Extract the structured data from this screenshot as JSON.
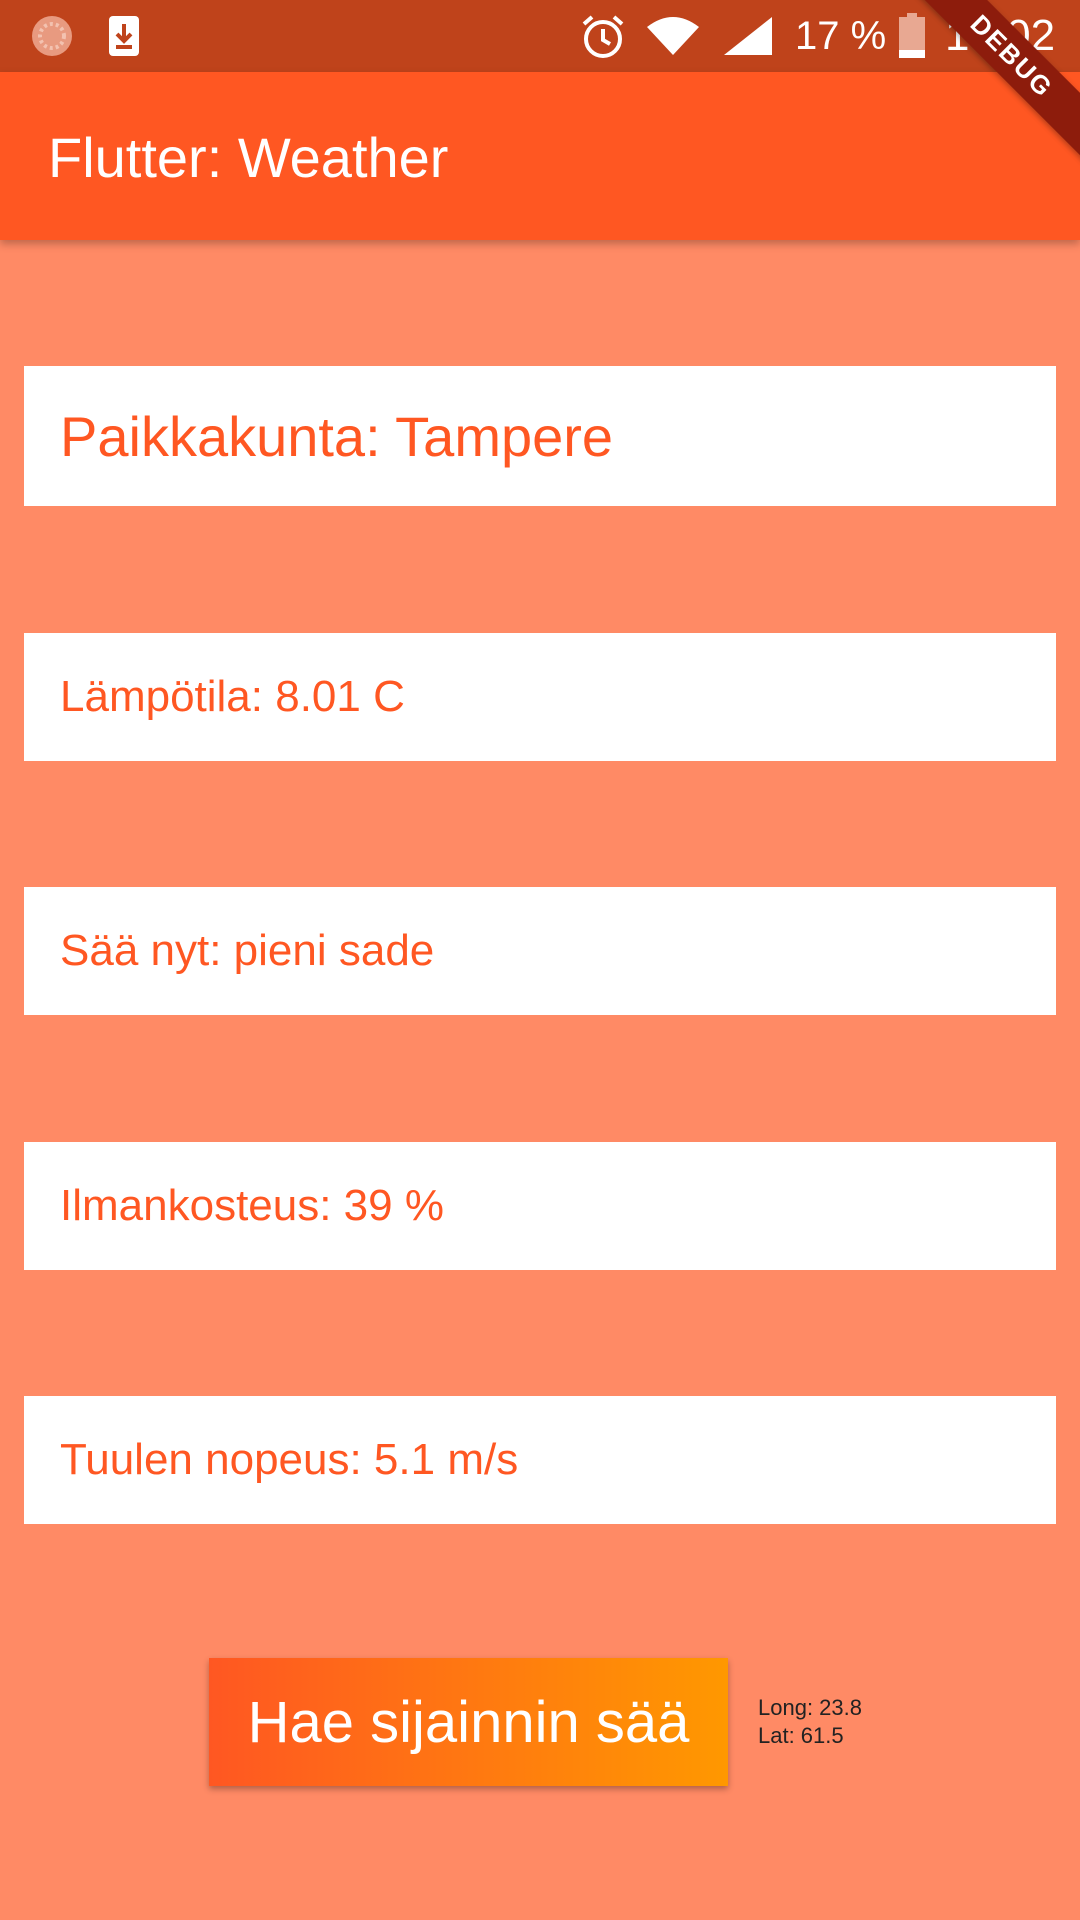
{
  "status_bar": {
    "battery_percent": "17 %",
    "time": "19.02",
    "icons": [
      "app-icon",
      "download-icon",
      "alarm-icon",
      "wifi-icon",
      "signal-icon",
      "battery-icon"
    ]
  },
  "app_bar": {
    "title": "Flutter: Weather"
  },
  "debug_banner": {
    "label": "DEBUG"
  },
  "weather": {
    "city": "Paikkakunta: Tampere",
    "temperature": "Lämpötila: 8.01 C",
    "condition": "Sää nyt: pieni sade",
    "humidity": "Ilmankosteus: 39 %",
    "wind": "Tuulen nopeus: 5.1 m/s"
  },
  "actions": {
    "fetch_label": "Hae sijainnin sää"
  },
  "location": {
    "long": "Long: 23.8",
    "lat": "Lat: 61.5"
  },
  "colors": {
    "background": "#ff8a65",
    "primary": "#ff5722",
    "status_bar": "#bf431b",
    "gradient_end": "#ff9800"
  }
}
